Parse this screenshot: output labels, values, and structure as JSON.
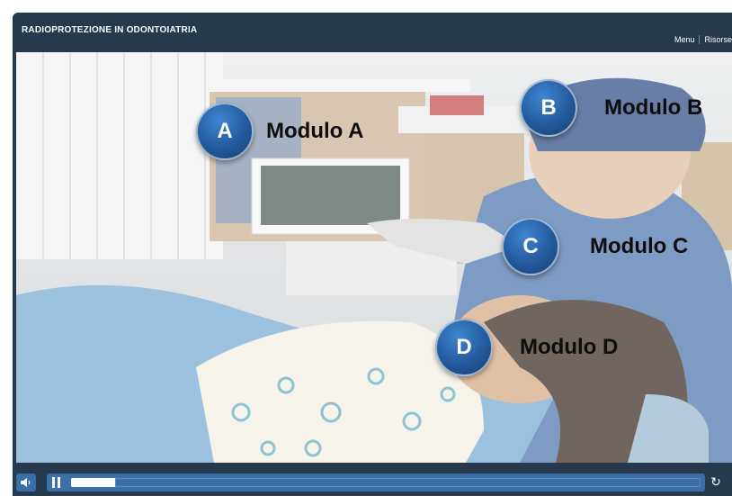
{
  "header": {
    "title": "RADIOPROTEZIONE IN ODONTOIATRIA",
    "nav": [
      {
        "label": "Menu"
      },
      {
        "label": "Risorse"
      }
    ]
  },
  "hotspots": [
    {
      "letter": "A",
      "label": "Modulo A"
    },
    {
      "letter": "B",
      "label": "Modulo B"
    },
    {
      "letter": "C",
      "label": "Modulo C"
    },
    {
      "letter": "D",
      "label": "Modulo D"
    }
  ],
  "player": {
    "progress_fraction": 0.07
  },
  "colors": {
    "frame": "#26394d",
    "accent": "#3b6fa8",
    "hotspot": "#235a9c"
  },
  "icons": {
    "sound": "speaker-icon",
    "pause": "pause-icon",
    "replay": "replay-icon"
  }
}
